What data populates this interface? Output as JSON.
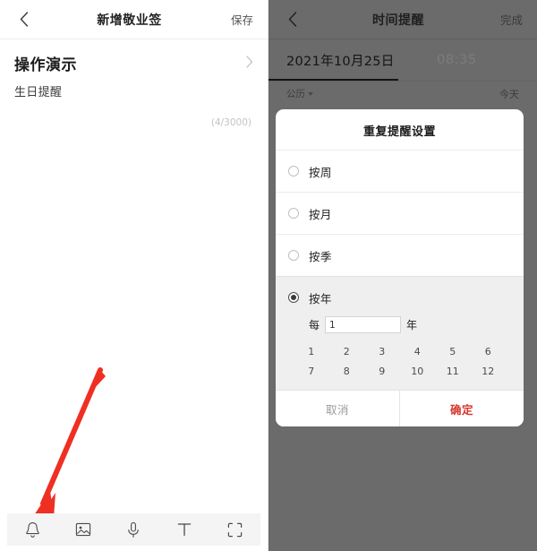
{
  "left_screen": {
    "header": {
      "back_icon": "chevron-left-icon",
      "title": "新增敬业签",
      "save_label": "保存"
    },
    "note": {
      "title": "操作演示",
      "chevron_icon": "chevron-right-icon",
      "subtitle": "生日提醒",
      "char_count": "(4/3000)"
    },
    "toolbar": {
      "items": [
        {
          "icon": "bell-icon",
          "name": "reminder"
        },
        {
          "icon": "image-icon",
          "name": "image"
        },
        {
          "icon": "microphone-icon",
          "name": "voice"
        },
        {
          "icon": "text-format-icon",
          "name": "text"
        },
        {
          "icon": "fullscreen-icon",
          "name": "fullscreen"
        }
      ]
    },
    "annotation": {
      "type": "arrow",
      "color": "#ef2f22",
      "points_to": "bell-icon"
    }
  },
  "right_screen": {
    "header": {
      "back_icon": "chevron-left-icon",
      "title": "时间提醒",
      "done_label": "完成"
    },
    "datetime": {
      "date": "2021年10月25日",
      "time": "08:35"
    },
    "calendar_bar": {
      "calendar_type": "公历",
      "caret_icon": "caret-down-icon",
      "today_label": "今天"
    },
    "dialog": {
      "title": "重复提醒设置",
      "options": [
        {
          "label": "按周",
          "selected": false
        },
        {
          "label": "按月",
          "selected": false
        },
        {
          "label": "按季",
          "selected": false
        },
        {
          "label": "按年",
          "selected": true
        }
      ],
      "interval": {
        "prefix": "每",
        "value": "1",
        "placeholder": "1",
        "suffix": "年"
      },
      "number_grid": [
        "1",
        "2",
        "3",
        "4",
        "5",
        "6",
        "7",
        "8",
        "9",
        "10",
        "11",
        "12"
      ],
      "actions": {
        "cancel_label": "取消",
        "confirm_label": "确定",
        "confirm_color": "#d9352c"
      }
    }
  }
}
